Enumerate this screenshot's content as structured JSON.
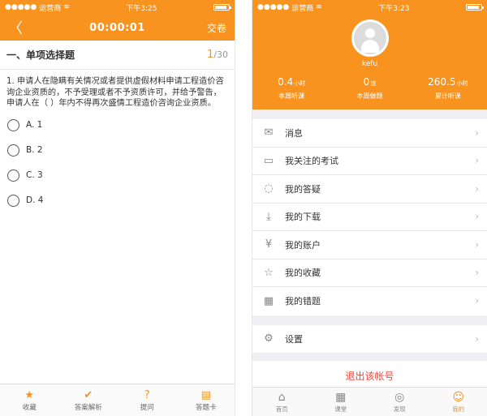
{
  "left": {
    "status": {
      "carrier": "运营商",
      "wifi": "wifi-icon",
      "time": "下午3:25"
    },
    "nav": {
      "back_icon": "back-icon",
      "timer": "00:00:01",
      "submit": "交卷"
    },
    "section": {
      "title": "一、单项选择题",
      "current": "1",
      "total": "/30"
    },
    "question": "1. 申请人在隐瞒有关情况或者提供虚假材料申请工程造价咨询企业资质的，不予受理或者不予资质许可，并给予警告，申请人在（   ）年内不得再次盛情工程造价咨询企业资质。",
    "options": [
      "A. 1",
      "B. 2",
      "C. 3",
      "D. 4"
    ],
    "bottom": [
      {
        "icon": "★",
        "label": "收藏"
      },
      {
        "icon": "✔",
        "label": "答案解析"
      },
      {
        "icon": "?",
        "label": "提问"
      },
      {
        "icon": "▤",
        "label": "答题卡"
      }
    ]
  },
  "right": {
    "status": {
      "carrier": "运营商",
      "time": "下午3:23"
    },
    "username": "kefu",
    "stats": [
      {
        "value": "0.4",
        "unit": "小时",
        "label": "本周听课"
      },
      {
        "value": "0",
        "unit": "道",
        "label": "本周做题"
      },
      {
        "value": "260.5",
        "unit": "小时",
        "label": "累计听课"
      }
    ],
    "menu": [
      {
        "icon": "✉",
        "label": "消息"
      },
      {
        "icon": "▭",
        "label": "我关注的考试"
      },
      {
        "icon": "◌",
        "label": "我的答疑"
      },
      {
        "icon": "⤓",
        "label": "我的下载"
      },
      {
        "icon": "¥",
        "label": "我的账户"
      },
      {
        "icon": "☆",
        "label": "我的收藏"
      },
      {
        "icon": "▦",
        "label": "我的错题"
      }
    ],
    "settings": {
      "icon": "⚙",
      "label": "设置"
    },
    "logout": "退出该帐号",
    "tabs": [
      {
        "icon": "⌂",
        "label": "首页",
        "active": false
      },
      {
        "icon": "▦",
        "label": "课堂",
        "active": false
      },
      {
        "icon": "◎",
        "label": "发现",
        "active": false
      },
      {
        "icon": "☺",
        "label": "我的",
        "active": true
      }
    ]
  }
}
